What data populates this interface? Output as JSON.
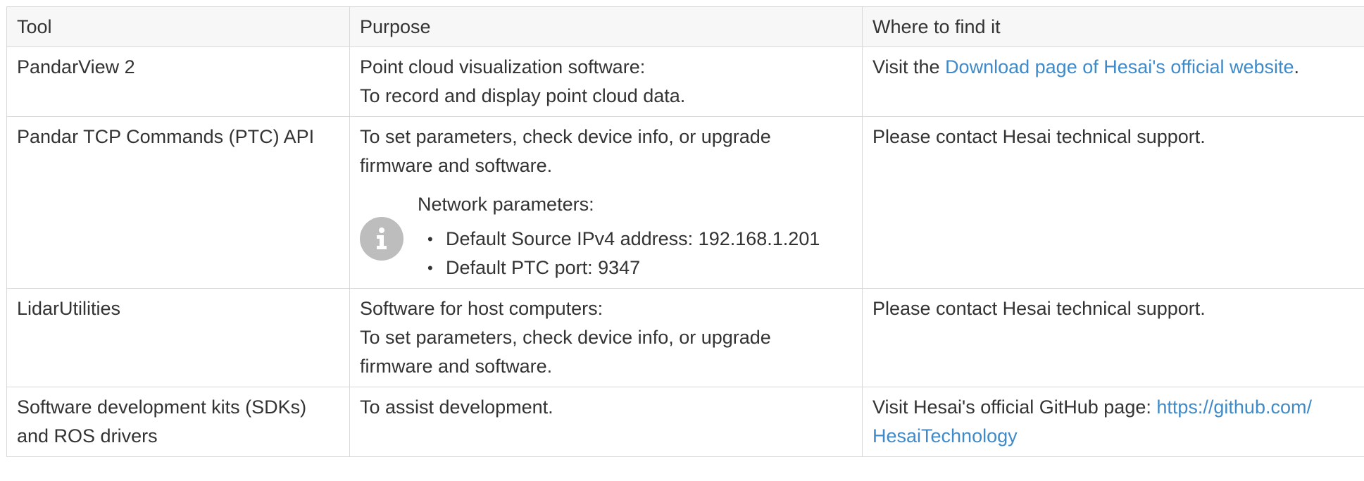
{
  "table": {
    "headers": {
      "tool": "Tool",
      "purpose": "Purpose",
      "where": "Where to find it"
    },
    "rows": [
      {
        "tool": "PandarView 2",
        "purpose_line1": "Point cloud visualization software:",
        "purpose_line2": "To record and display point cloud data.",
        "where_prefix": "Visit the ",
        "where_link": "Download page of Hesai's official website",
        "where_suffix": "."
      },
      {
        "tool": "Pandar TCP Commands (PTC) API",
        "purpose_line1": "To set parameters, check device info, or upgrade",
        "purpose_line2": "firmware and software.",
        "note_title": "Network parameters:",
        "note_items": [
          "Default Source IPv4 address: 192.168.1.201",
          "Default PTC port: 9347"
        ],
        "note_icon": "info-icon",
        "where_text": "Please contact Hesai technical support."
      },
      {
        "tool": "LidarUtilities",
        "purpose_line1": "Software for host computers:",
        "purpose_line2": "To set parameters, check device info, or upgrade",
        "purpose_line3": "firmware and software.",
        "where_text": "Please contact Hesai technical support."
      },
      {
        "tool_line1": "Software development kits (SDKs)",
        "tool_line2": "and ROS drivers",
        "purpose_line1": "To assist development.",
        "where_prefix": "Visit Hesai's official GitHub page: ",
        "where_link_line1": "https://github.com/",
        "where_link_line2": "HesaiTechnology"
      }
    ]
  },
  "colors": {
    "link": "#3f8ac8",
    "border": "#d9d9d9",
    "header_bg": "#f7f7f7",
    "text": "#333333",
    "note_icon_bg": "#bdbdbd"
  }
}
